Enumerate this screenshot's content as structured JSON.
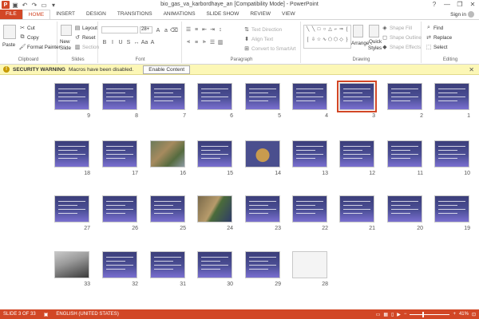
{
  "window": {
    "title": "bio_gas_va_karbordhaye_an [Compatibility Mode] - PowerPoint",
    "app_icon_letter": "P",
    "controls": [
      "?",
      "—",
      "❐",
      "✕"
    ]
  },
  "qat": {
    "save_icon": "save-icon",
    "undo_icon": "undo-icon",
    "redo_icon": "redo-icon",
    "start_icon": "start-from-beginning-icon"
  },
  "tabs": [
    "FILE",
    "HOME",
    "INSERT",
    "DESIGN",
    "TRANSITIONS",
    "ANIMATIONS",
    "SLIDE SHOW",
    "REVIEW",
    "VIEW"
  ],
  "active_tab": "HOME",
  "signin": "Sign in",
  "ribbon": {
    "clipboard": {
      "label": "Clipboard",
      "paste": "Paste",
      "cut": "Cut",
      "copy": "Copy",
      "format_painter": "Format Painter"
    },
    "slides": {
      "label": "Slides",
      "new_slide_line1": "New",
      "new_slide_line2": "Slide",
      "layout": "Layout",
      "reset": "Reset",
      "section": "Section"
    },
    "font": {
      "label": "Font",
      "size": "28+"
    },
    "paragraph": {
      "label": "Paragraph",
      "text_direction": "Text Direction",
      "align_text": "Align Text",
      "convert_smartart": "Convert to SmartArt"
    },
    "drawing": {
      "label": "Drawing",
      "arrange": "Arrange",
      "quick_styles_line1": "Quick",
      "quick_styles_line2": "Styles",
      "shape_fill": "Shape Fill",
      "shape_outline": "Shape Outline",
      "shape_effects": "Shape Effects"
    },
    "editing": {
      "label": "Editing",
      "find": "Find",
      "replace": "Replace",
      "select": "Select"
    }
  },
  "security": {
    "title": "SECURITY WARNING",
    "message": "Macros have been disabled.",
    "button": "Enable Content"
  },
  "slides": [
    {
      "n": "9"
    },
    {
      "n": "8"
    },
    {
      "n": "7"
    },
    {
      "n": "6"
    },
    {
      "n": "5"
    },
    {
      "n": "4"
    },
    {
      "n": "3"
    },
    {
      "n": "2"
    },
    {
      "n": "1"
    },
    {
      "n": "18"
    },
    {
      "n": "17"
    },
    {
      "n": "16"
    },
    {
      "n": "15"
    },
    {
      "n": "14"
    },
    {
      "n": "13"
    },
    {
      "n": "12"
    },
    {
      "n": "11"
    },
    {
      "n": "10"
    },
    {
      "n": "27"
    },
    {
      "n": "26"
    },
    {
      "n": "25"
    },
    {
      "n": "24"
    },
    {
      "n": "23"
    },
    {
      "n": "22"
    },
    {
      "n": "21"
    },
    {
      "n": "20"
    },
    {
      "n": "19"
    },
    {
      "n": "33"
    },
    {
      "n": "32"
    },
    {
      "n": "31"
    },
    {
      "n": "30"
    },
    {
      "n": "29"
    },
    {
      "n": "28"
    }
  ],
  "selected_slide": "3",
  "status": {
    "slide_info": "SLIDE 3 OF 33",
    "language": "ENGLISH (UNITED STATES)",
    "zoom": "41%"
  }
}
